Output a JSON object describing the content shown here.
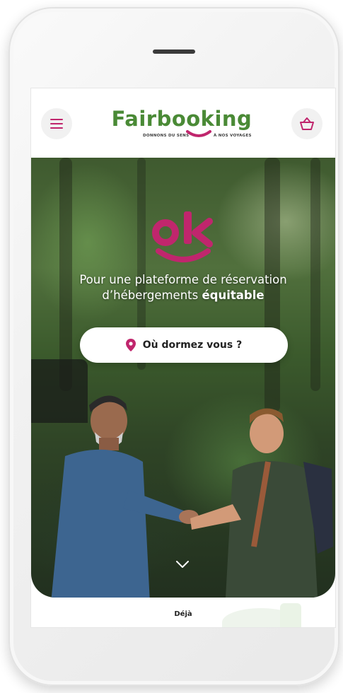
{
  "header": {
    "brand": "Fairbooking",
    "tagline_left": "DONNONS DU SENS",
    "tagline_right": "À NOS VOYAGES",
    "menu_icon": "hamburger-icon",
    "basket_icon": "basket-icon"
  },
  "hero": {
    "logo_text": "ok",
    "tagline_line1": "Pour une plateforme de réservation",
    "tagline_line2_prefix": "d’hébergements ",
    "tagline_line2_bold": "équitable",
    "search_button_label": "Où dormez vous ?",
    "search_icon": "location-pin-icon",
    "scroll_icon": "chevron-down-icon"
  },
  "footer": {
    "partial_text": "Déjà"
  },
  "colors": {
    "brand_green": "#4a8a36",
    "brand_pink": "#c0266d",
    "white": "#ffffff"
  }
}
